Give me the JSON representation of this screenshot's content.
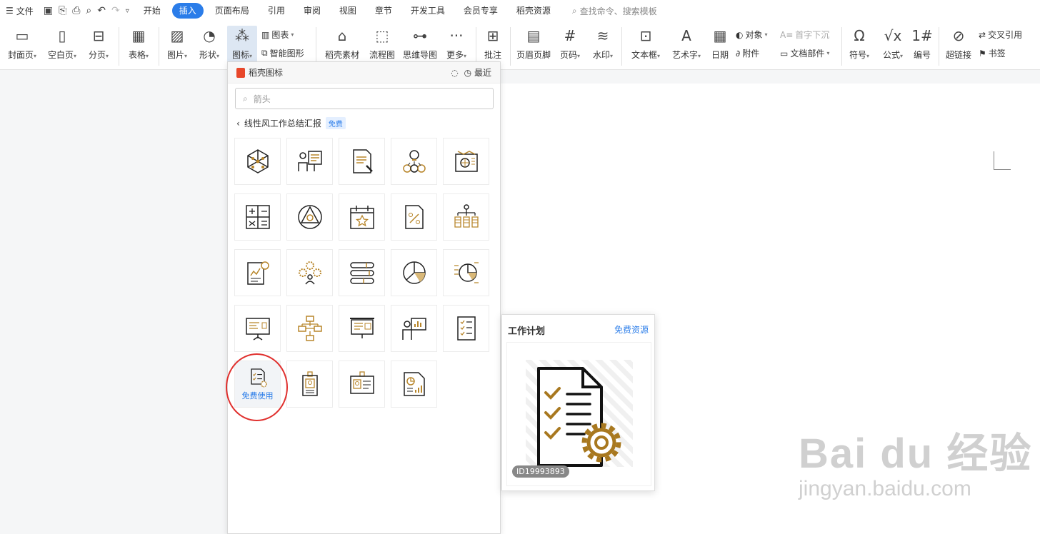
{
  "menubar": {
    "file_label": "文件",
    "tabs": [
      {
        "label": "开始"
      },
      {
        "label": "插入"
      },
      {
        "label": "页面布局"
      },
      {
        "label": "引用"
      },
      {
        "label": "审阅"
      },
      {
        "label": "视图"
      },
      {
        "label": "章节"
      },
      {
        "label": "开发工具"
      },
      {
        "label": "会员专享"
      },
      {
        "label": "稻壳资源"
      }
    ],
    "active_tab": "插入",
    "search_placeholder": "查找命令、搜索模板"
  },
  "ribbon": {
    "cover": "封面页",
    "blank": "空白页",
    "break": "分页",
    "table": "表格",
    "picture": "图片",
    "shape": "形状",
    "icon": "图标",
    "chart": "图表",
    "smartart": "智能图形",
    "docer_material": "稻壳素材",
    "flowchart": "流程图",
    "mindmap": "思维导图",
    "more": "更多",
    "comment": "批注",
    "header_footer": "页眉页脚",
    "page_number": "页码",
    "watermark": "水印",
    "textbox": "文本框",
    "wordart": "艺术字",
    "date": "日期",
    "object": "对象",
    "attachment": "附件",
    "dropcap": "首字下沉",
    "doc_parts": "文档部件",
    "symbol": "符号",
    "equation": "公式",
    "numbering": "编号",
    "hyperlink": "超链接",
    "cross_ref": "交叉引用",
    "bookmark": "书签"
  },
  "panel": {
    "title": "稻壳图标",
    "recent": "最近",
    "search_placeholder": "箭头",
    "category": "线性风工作总结汇报",
    "category_badge": "免费",
    "hover_label": "免费使用",
    "icons": [
      "cube-network",
      "presenter-board",
      "document-pen",
      "lightbulb-team",
      "blueprint",
      "calculator-grid",
      "compass-triangle",
      "calendar-star",
      "percent-document",
      "hierarchy-coins",
      "report-chart",
      "gears-person",
      "stacked-bars",
      "pie-chart",
      "pie-list",
      "projector-screen",
      "org-chart",
      "presentation-board",
      "presenter-chart",
      "checklist",
      "checklist-gear",
      "id-badge",
      "id-card",
      "report-graph"
    ]
  },
  "preview": {
    "title": "工作计划",
    "link": "免费资源",
    "id": "ID19993893"
  },
  "watermark": {
    "brand": "Bai du 经验",
    "url": "jingyan.baidu.com"
  }
}
